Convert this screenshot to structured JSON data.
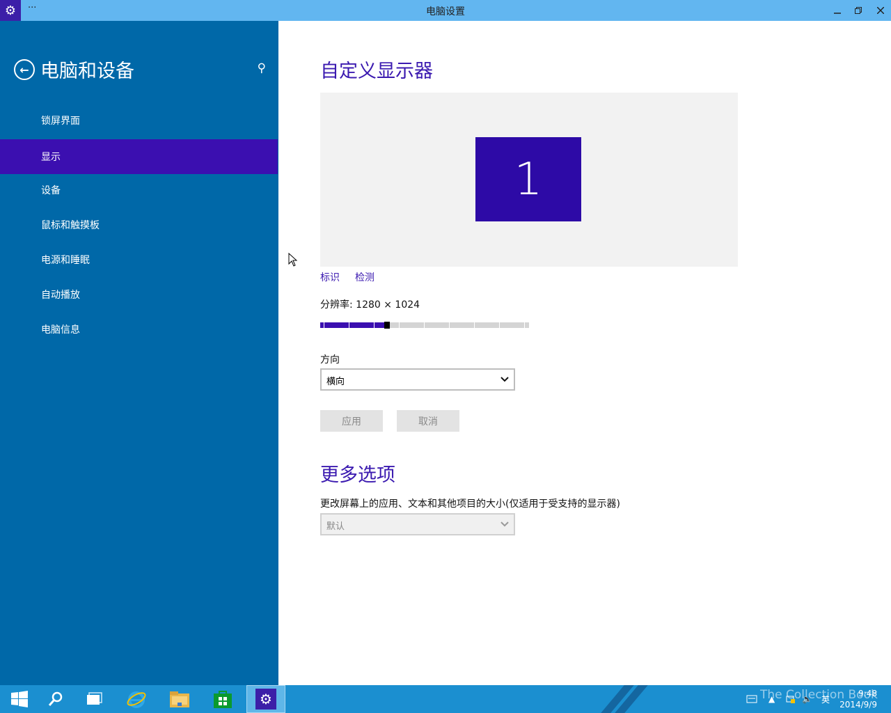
{
  "window": {
    "title": "电脑设置",
    "menu_dots": "···"
  },
  "sidebar": {
    "title": "电脑和设备",
    "items": [
      {
        "label": "锁屏界面",
        "active": false
      },
      {
        "label": "显示",
        "active": true
      },
      {
        "label": "设备",
        "active": false
      },
      {
        "label": "鼠标和触摸板",
        "active": false
      },
      {
        "label": "电源和睡眠",
        "active": false
      },
      {
        "label": "自动播放",
        "active": false
      },
      {
        "label": "电脑信息",
        "active": false
      }
    ]
  },
  "main": {
    "section1_title": "自定义显示器",
    "monitor_number": "1",
    "links": {
      "identify": "标识",
      "detect": "检测"
    },
    "resolution_label": "分辨率: 1280 × 1024",
    "resolution_slider_fraction": 0.32,
    "orientation_label": "方向",
    "orientation_value": "横向",
    "apply_button": "应用",
    "cancel_button": "取消",
    "section2_title": "更多选项",
    "scale_description": "更改屏幕上的应用、文本和其他项目的大小(仅适用于受支持的显示器)",
    "scale_value": "默认"
  },
  "taskbar": {
    "watermark": "The Collection Book",
    "time": "9:48",
    "date": "2014/9/9",
    "ime": "英"
  },
  "colors": {
    "accent": "#3b0fb0",
    "sidebar_bg": "#0068a8",
    "titlebar_bg": "#62b6f0",
    "taskbar_bg": "#1b8fd0"
  }
}
